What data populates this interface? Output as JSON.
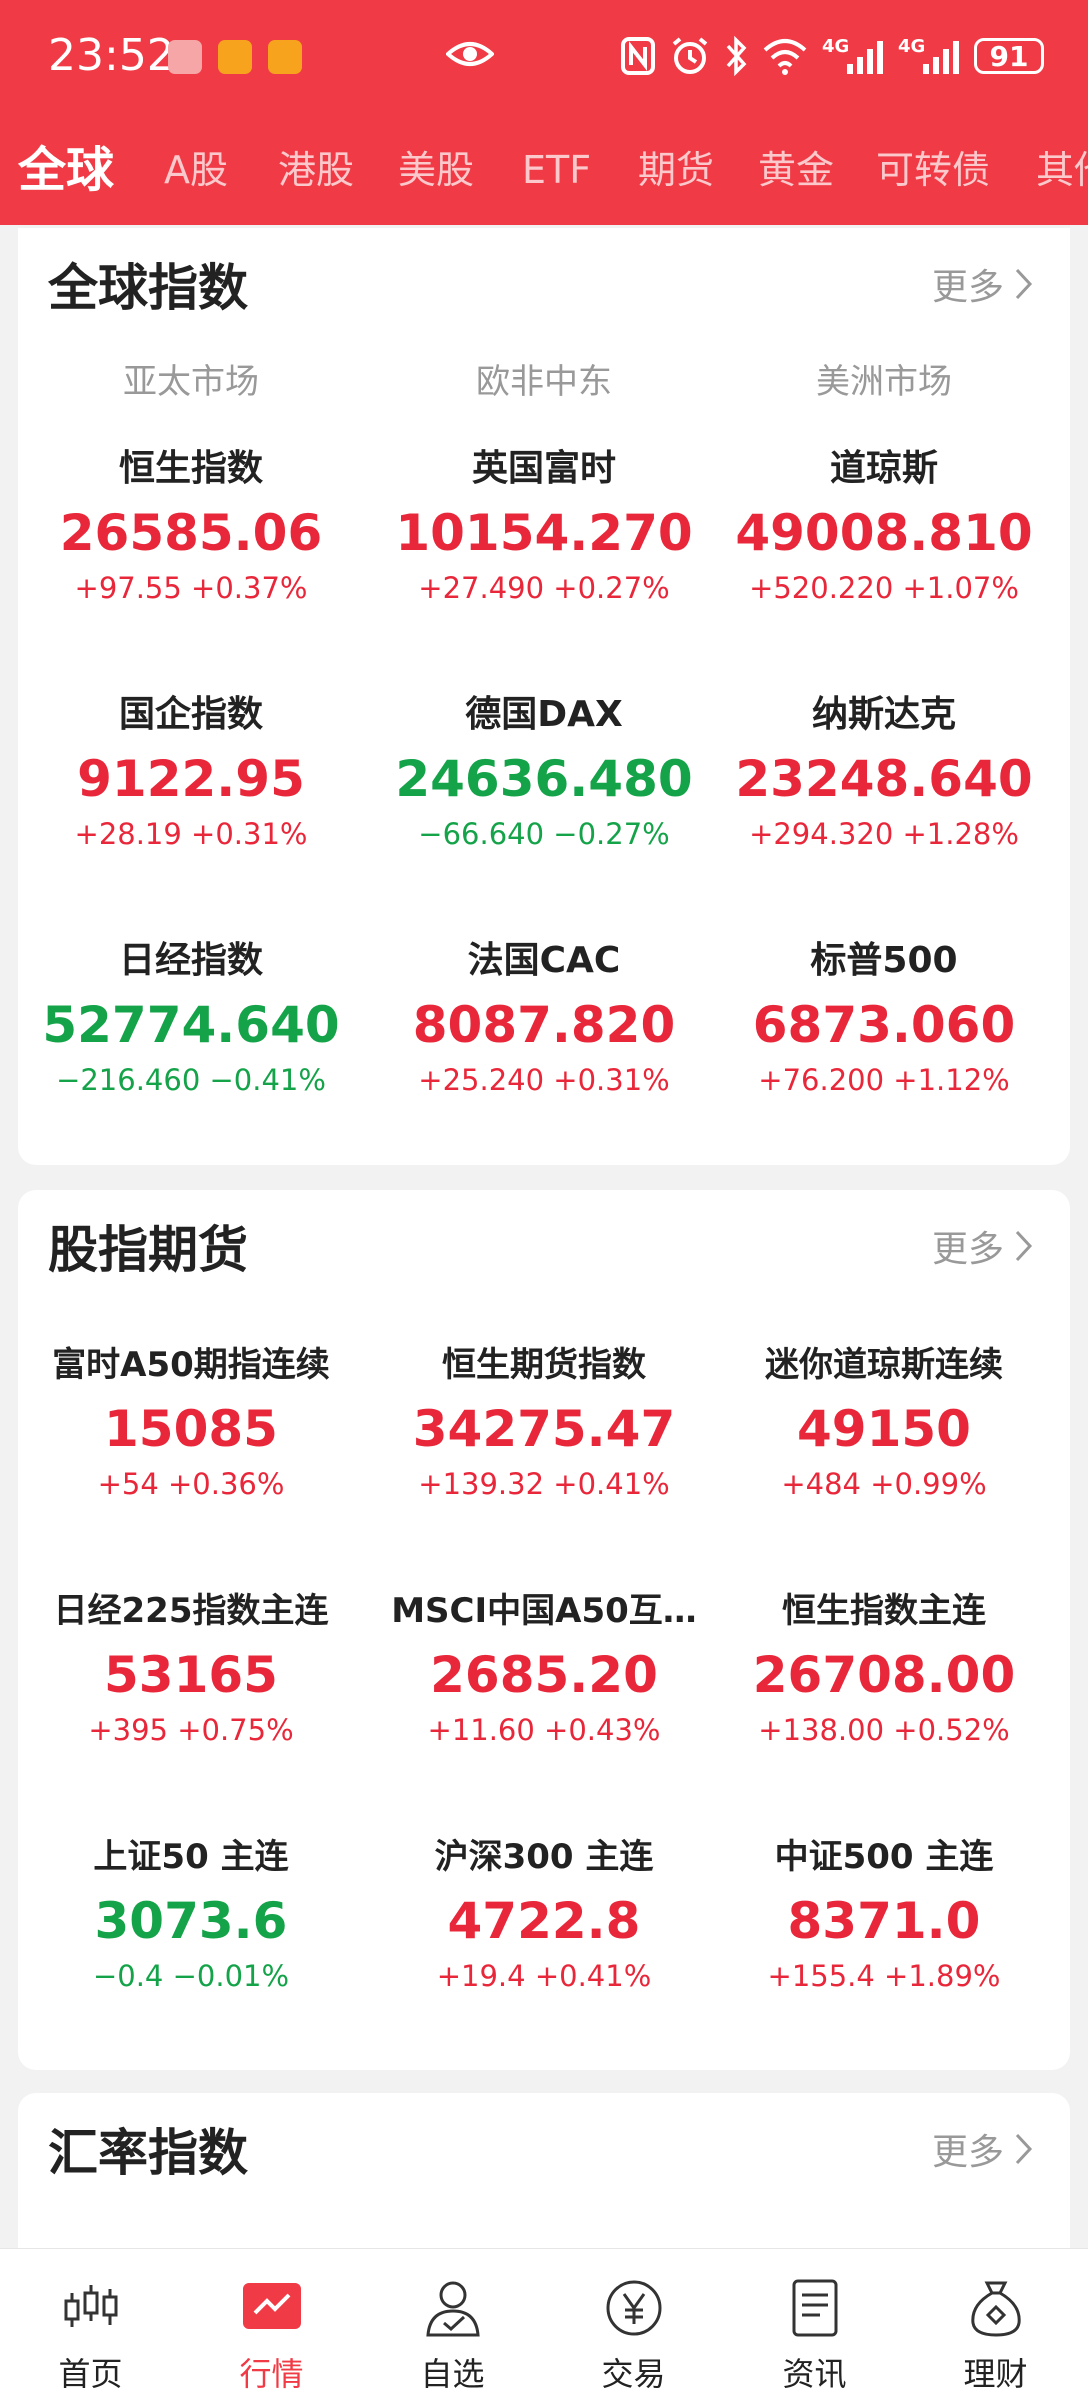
{
  "status_bar": {
    "time": "23:52",
    "battery": "91",
    "net1": "4G",
    "net2": "4G"
  },
  "tabs": [
    {
      "label": "全球",
      "active": true
    },
    {
      "label": "A股"
    },
    {
      "label": "港股"
    },
    {
      "label": "美股"
    },
    {
      "label": "ETF"
    },
    {
      "label": "期货"
    },
    {
      "label": "黄金"
    },
    {
      "label": "可转债"
    },
    {
      "label": "其他"
    }
  ],
  "global_indices": {
    "title": "全球指数",
    "more": "更多",
    "regions": [
      "亚太市场",
      "欧非中东",
      "美洲市场"
    ],
    "items": [
      {
        "name": "恒生指数",
        "price": "26585.06",
        "change": "+97.55 +0.37%",
        "trend": "up"
      },
      {
        "name": "英国富时",
        "price": "10154.270",
        "change": "+27.490 +0.27%",
        "trend": "up"
      },
      {
        "name": "道琼斯",
        "price": "49008.810",
        "change": "+520.220 +1.07%",
        "trend": "up"
      },
      {
        "name": "国企指数",
        "price": "9122.95",
        "change": "+28.19 +0.31%",
        "trend": "up"
      },
      {
        "name": "德国DAX",
        "price": "24636.480",
        "change": "−66.640 −0.27%",
        "trend": "down"
      },
      {
        "name": "纳斯达克",
        "price": "23248.640",
        "change": "+294.320 +1.28%",
        "trend": "up"
      },
      {
        "name": "日经指数",
        "price": "52774.640",
        "change": "−216.460 −0.41%",
        "trend": "down"
      },
      {
        "name": "法国CAC",
        "price": "8087.820",
        "change": "+25.240 +0.31%",
        "trend": "up"
      },
      {
        "name": "标普500",
        "price": "6873.060",
        "change": "+76.200 +1.12%",
        "trend": "up"
      }
    ]
  },
  "index_futures": {
    "title": "股指期货",
    "more": "更多",
    "items": [
      {
        "name": "富时A50期指连续",
        "price": "15085",
        "change": "+54 +0.36%",
        "trend": "up"
      },
      {
        "name": "恒生期货指数",
        "price": "34275.47",
        "change": "+139.32 +0.41%",
        "trend": "up"
      },
      {
        "name": "迷你道琼斯连续",
        "price": "49150",
        "change": "+484 +0.99%",
        "trend": "up"
      },
      {
        "name": "日经225指数主连",
        "price": "53165",
        "change": "+395 +0.75%",
        "trend": "up"
      },
      {
        "name": "MSCI中国A50互…",
        "price": "2685.20",
        "change": "+11.60 +0.43%",
        "trend": "up"
      },
      {
        "name": "恒生指数主连",
        "price": "26708.00",
        "change": "+138.00 +0.52%",
        "trend": "up"
      },
      {
        "name": "上证50 主连",
        "price": "3073.6",
        "change": "−0.4 −0.01%",
        "trend": "down"
      },
      {
        "name": "沪深300 主连",
        "price": "4722.8",
        "change": "+19.4 +0.41%",
        "trend": "up"
      },
      {
        "name": "中证500 主连",
        "price": "8371.0",
        "change": "+155.4 +1.89%",
        "trend": "up"
      }
    ]
  },
  "fx_indices": {
    "title": "汇率指数",
    "more": "更多"
  },
  "bottom_nav": [
    {
      "label": "首页",
      "icon": "candlestick-icon"
    },
    {
      "label": "行情",
      "icon": "market-chart-icon",
      "active": true
    },
    {
      "label": "自选",
      "icon": "person-check-icon"
    },
    {
      "label": "交易",
      "icon": "yen-icon"
    },
    {
      "label": "资讯",
      "icon": "document-icon"
    },
    {
      "label": "理财",
      "icon": "money-bag-icon"
    }
  ],
  "colors": {
    "brand": "#f03a45",
    "up": "#e8283a",
    "down": "#15a34a"
  }
}
